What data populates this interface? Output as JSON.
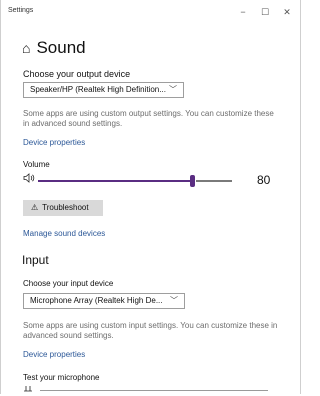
{
  "window": {
    "title": "Settings",
    "min_glyph": "−",
    "max_glyph": "☐",
    "close_glyph": "✕"
  },
  "page": {
    "title": "Sound",
    "home_icon": "⌂"
  },
  "output": {
    "heading": "Choose your output device",
    "device": "Speaker/HP (Realtek High Definition...",
    "help": "Some apps are using custom output settings. You can customize these in advanced sound settings.",
    "device_properties": "Device properties",
    "volume_label": "Volume",
    "volume_value": "80",
    "volume_fraction": 0.8,
    "troubleshoot": "Troubleshoot",
    "manage": "Manage sound devices"
  },
  "input": {
    "heading": "Input",
    "choose_heading": "Choose your input device",
    "device": "Microphone Array (Realtek High De...",
    "help": "Some apps are using custom input settings. You can customize these in advanced sound settings.",
    "device_properties": "Device properties",
    "test_label": "Test your microphone"
  },
  "colors": {
    "accent": "#5a2d82",
    "link": "#2b5797"
  }
}
